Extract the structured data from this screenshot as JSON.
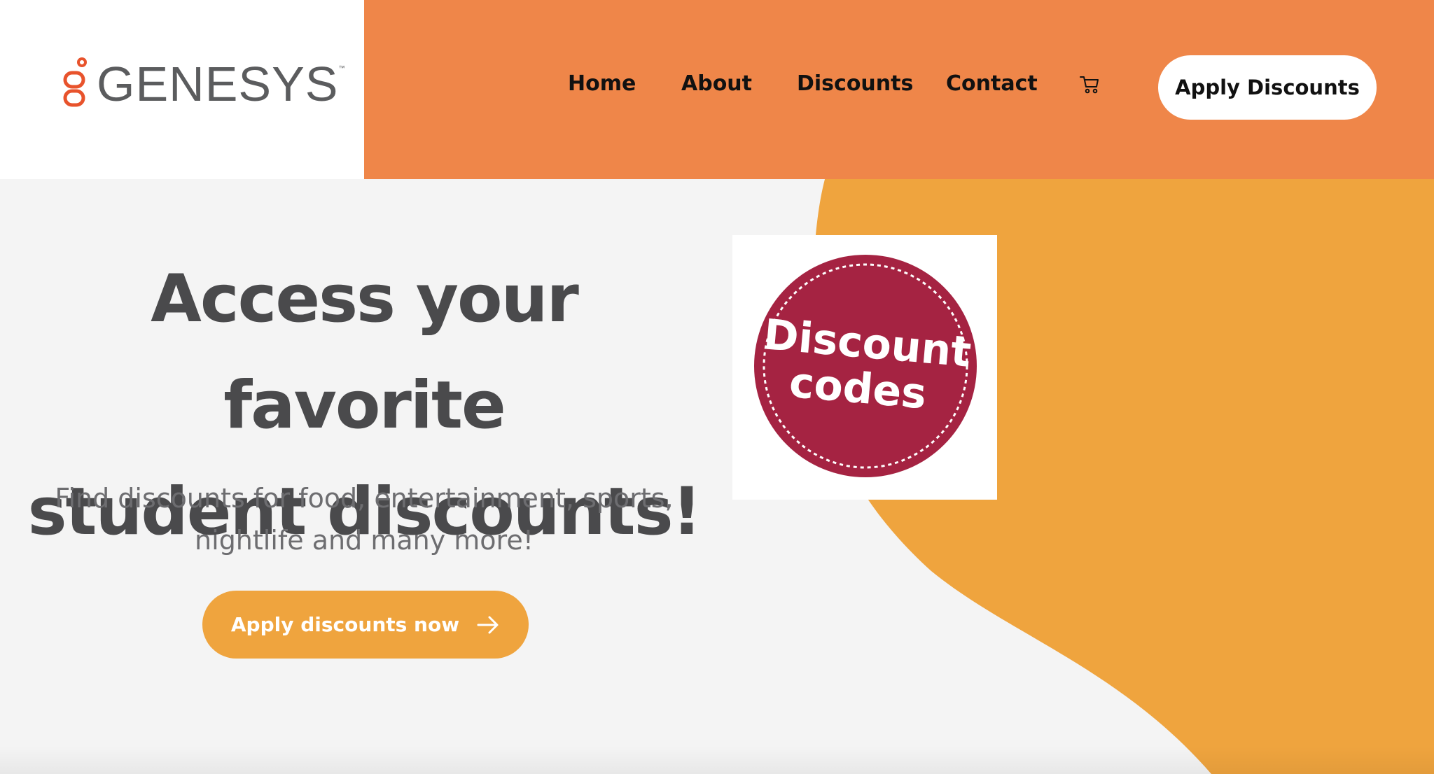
{
  "brand": {
    "name": "GENESYS",
    "trademark": "™"
  },
  "nav": {
    "items": [
      {
        "label": "Home"
      },
      {
        "label": "About"
      },
      {
        "label": "Discounts"
      },
      {
        "label": "Contact"
      }
    ],
    "cart_icon": "cart-icon",
    "apply_button": "Apply Discounts"
  },
  "hero": {
    "title_line1": "Access your favorite",
    "title_line2": "student discounts!",
    "subtitle_line1": "Find discounts for food, entertainment, sports,",
    "subtitle_line2": "nightlife and many more!",
    "cta_label": "Apply discounts now",
    "cta_icon": "arrow-right-icon"
  },
  "badge": {
    "line1": "Discount",
    "line2": "codes"
  },
  "colors": {
    "header_orange": "#ef8649",
    "accent_orange": "#efa43e",
    "badge_red": "#a52342",
    "text_dark": "#4a4a4c",
    "logo_red": "#e8532c"
  }
}
